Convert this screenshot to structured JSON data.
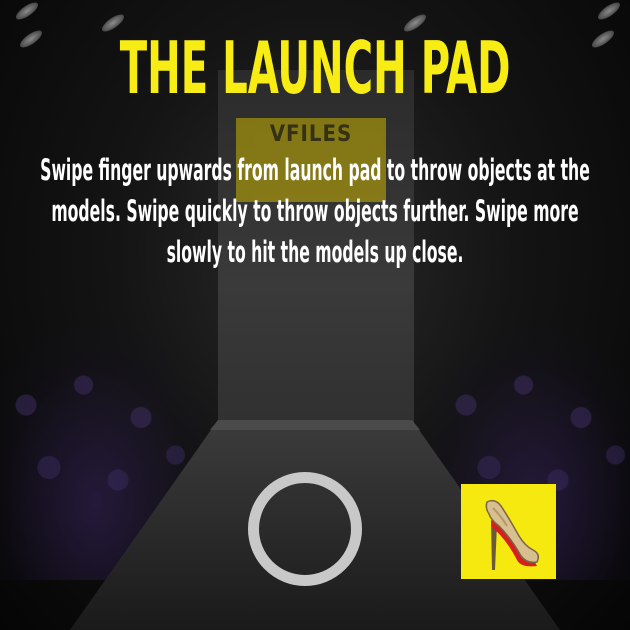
{
  "screen": {
    "title": "THE LAUNCH PAD",
    "instructions": "Swipe finger upwards from launch pad to throw objects at the models. Swipe quickly to throw objects further. Swipe more slowly to hit the models up close.",
    "backdrop_sign": "VFILES"
  },
  "launch_pad": {
    "icon": "ring-icon"
  },
  "selected_object": {
    "icon": "high-heel-shoe-icon"
  },
  "colors": {
    "accent_yellow": "#f7ec14",
    "text_white": "#ffffff",
    "pad_gray": "#c8c8c8",
    "shoe_sole_red": "#d81e1e"
  }
}
